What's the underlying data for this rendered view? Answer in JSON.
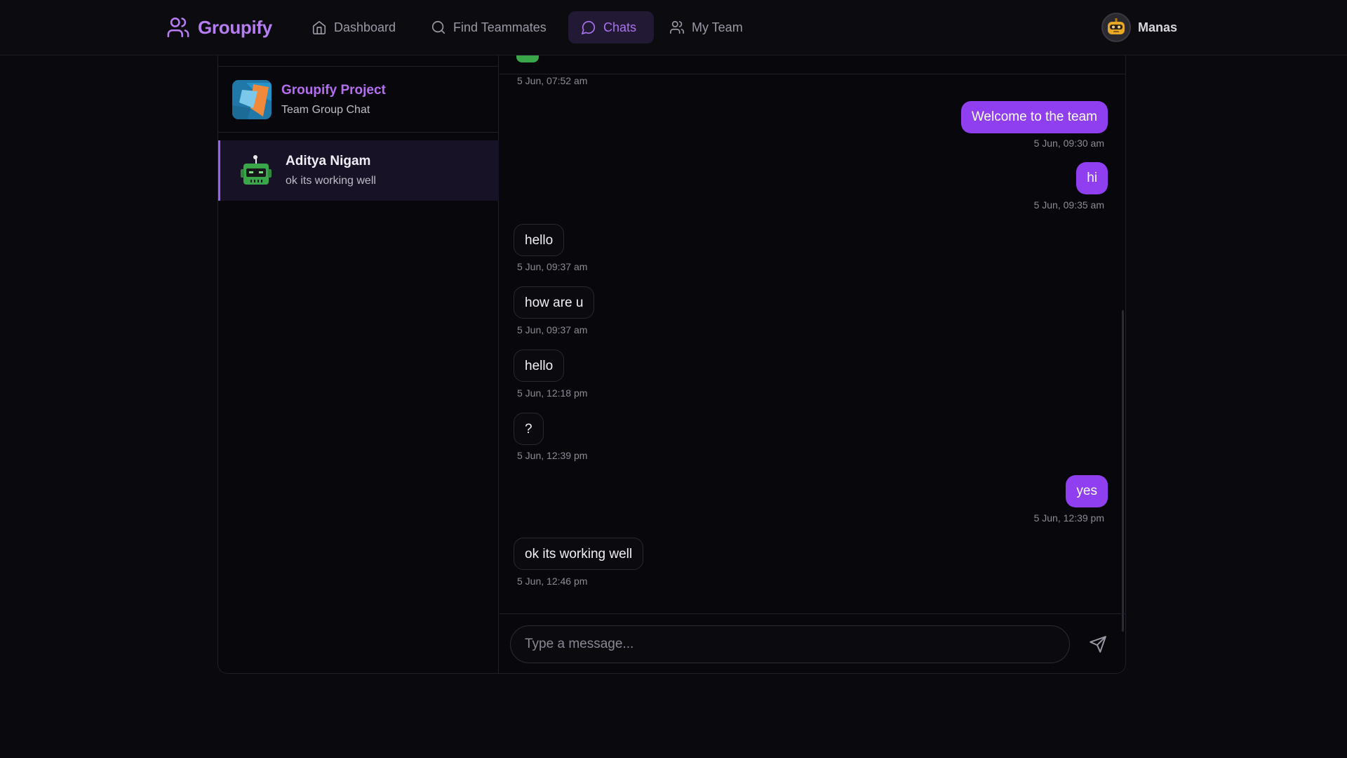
{
  "nav": {
    "brand": "Groupify",
    "items": [
      {
        "label": "Dashboard",
        "icon": "home-icon"
      },
      {
        "label": "Find Teammates",
        "icon": "search-icon"
      },
      {
        "label": "Chats",
        "icon": "chat-bubble-icon",
        "active": true
      },
      {
        "label": "My Team",
        "icon": "users-icon"
      }
    ],
    "user": {
      "name": "Manas"
    }
  },
  "colors": {
    "accent": "#8f3ff0",
    "brand": "#b77ef3",
    "background": "#0a090e"
  },
  "conversations": [
    {
      "title": "Groupify Project",
      "subtitle": "Team Group Chat"
    },
    {
      "title": "Aditya Nigam",
      "subtitle": "ok its working well",
      "selected": true
    }
  ],
  "chat": {
    "messages": [
      {
        "text": "",
        "time": "5 Jun, 07:52 am",
        "from": "them"
      },
      {
        "text": "Welcome to the team",
        "time": "5 Jun, 09:30 am",
        "from": "me"
      },
      {
        "text": "hi",
        "time": "5 Jun, 09:35 am",
        "from": "me"
      },
      {
        "text": "hello",
        "time": "5 Jun, 09:37 am",
        "from": "them"
      },
      {
        "text": "how are u",
        "time": "5 Jun, 09:37 am",
        "from": "them"
      },
      {
        "text": "hello",
        "time": "5 Jun, 12:18 pm",
        "from": "them"
      },
      {
        "text": "?",
        "time": "5 Jun, 12:39 pm",
        "from": "them"
      },
      {
        "text": "yes",
        "time": "5 Jun, 12:39 pm",
        "from": "me"
      },
      {
        "text": "ok its working well",
        "time": "5 Jun, 12:46 pm",
        "from": "them"
      }
    ],
    "input": {
      "value": "",
      "placeholder": "Type a message..."
    }
  }
}
